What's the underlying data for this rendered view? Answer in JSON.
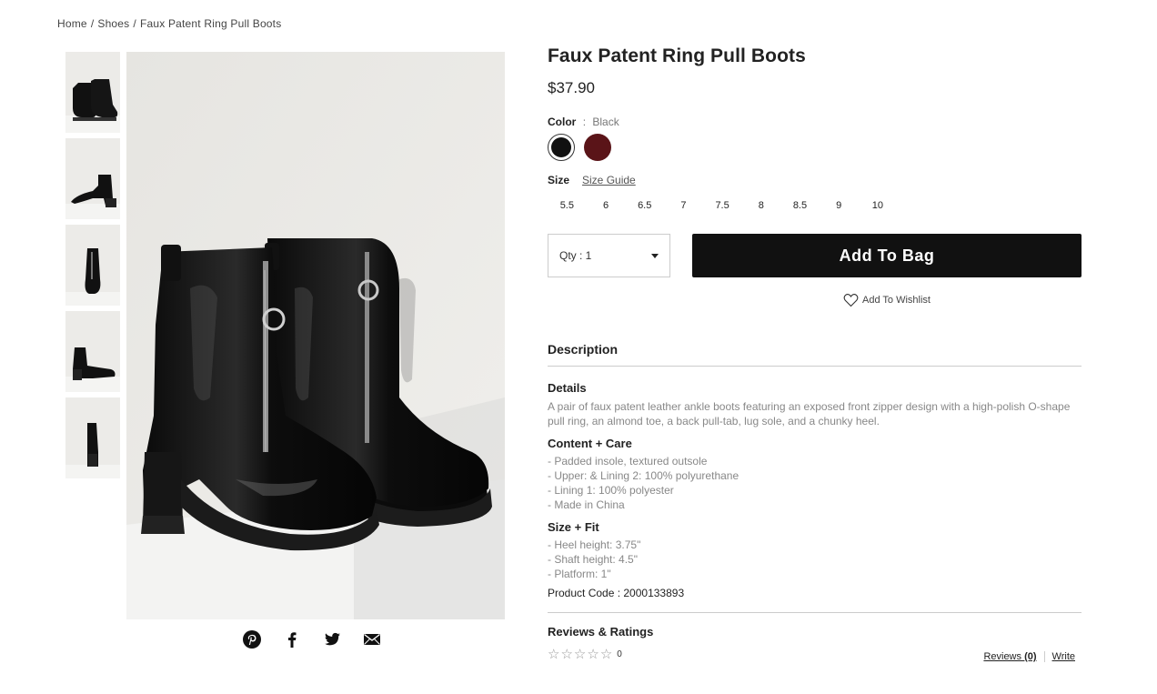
{
  "breadcrumb": {
    "home": "Home",
    "shoes": "Shoes",
    "current": "Faux Patent Ring Pull Boots",
    "separator": "/"
  },
  "product": {
    "title": "Faux Patent Ring Pull Boots",
    "price": "$37.90",
    "color_label": "Color",
    "color_separator": ":",
    "color_value": "Black",
    "swatches": [
      {
        "name": "Black",
        "hex": "#111111"
      },
      {
        "name": "Burgundy",
        "hex": "#5a1418"
      }
    ],
    "size_label": "Size",
    "size_guide": "Size Guide",
    "sizes": [
      "5.5",
      "6",
      "6.5",
      "7",
      "7.5",
      "8",
      "8.5",
      "9",
      "10"
    ],
    "qty_label": "Qty : 1",
    "add_to_bag": "Add To Bag",
    "wishlist": "Add To Wishlist"
  },
  "description": {
    "heading": "Description",
    "details_heading": "Details",
    "details_text": "A pair of faux patent leather ankle boots featuring an exposed front zipper design with a high-polish O-shape pull ring, an almond toe, a back pull-tab, lug sole, and a chunky heel.",
    "care_heading": "Content + Care",
    "care_items": [
      "- Padded insole, textured outsole",
      "- Upper: & Lining 2: 100% polyurethane",
      "- Lining 1: 100% polyester",
      "- Made in China"
    ],
    "fit_heading": "Size + Fit",
    "fit_items": [
      "- Heel height: 3.75\"",
      "- Shaft height: 4.5\"",
      "- Platform: 1\""
    ],
    "product_code": "Product Code : 2000133893"
  },
  "reviews": {
    "heading": "Reviews & Ratings",
    "count": "0",
    "reviews_link": "Reviews",
    "reviews_count": "(0)",
    "write_link": "Write"
  },
  "share": {
    "icons": [
      "pinterest-icon",
      "facebook-icon",
      "twitter-icon",
      "email-icon"
    ]
  },
  "colors": {
    "button_bg": "#111111",
    "text_primary": "#222222",
    "text_muted": "#888888"
  }
}
